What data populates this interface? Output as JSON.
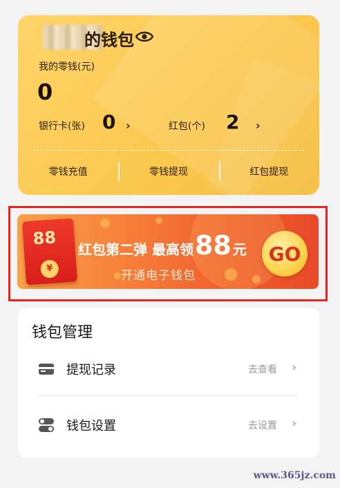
{
  "wallet": {
    "title": "的钱包",
    "change_label": "我的零钱(元)",
    "change_amount": "0",
    "bank_card_label": "银行卡(张)",
    "bank_card_count": "0",
    "red_packet_label": "红包(个)",
    "red_packet_count": "2",
    "actions": [
      "零钱充值",
      "零钱提现",
      "红包提现"
    ],
    "accent_color": "#fbc94f"
  },
  "promo": {
    "envelope_amount": "88",
    "envelope_coin": "¥",
    "text_prefix": "红包第二弹 最高领",
    "big_number": "88",
    "text_suffix": "元",
    "subtitle": "开通电子钱包",
    "go_label": "GO",
    "highlight_color": "#e8231c"
  },
  "manage": {
    "title": "钱包管理",
    "items": [
      {
        "label": "提现记录",
        "hint": "去查看",
        "icon": "wallet-card-icon"
      },
      {
        "label": "钱包设置",
        "hint": "去设置",
        "icon": "toggle-settings-icon"
      }
    ]
  },
  "watermark": "www.365jz.com"
}
